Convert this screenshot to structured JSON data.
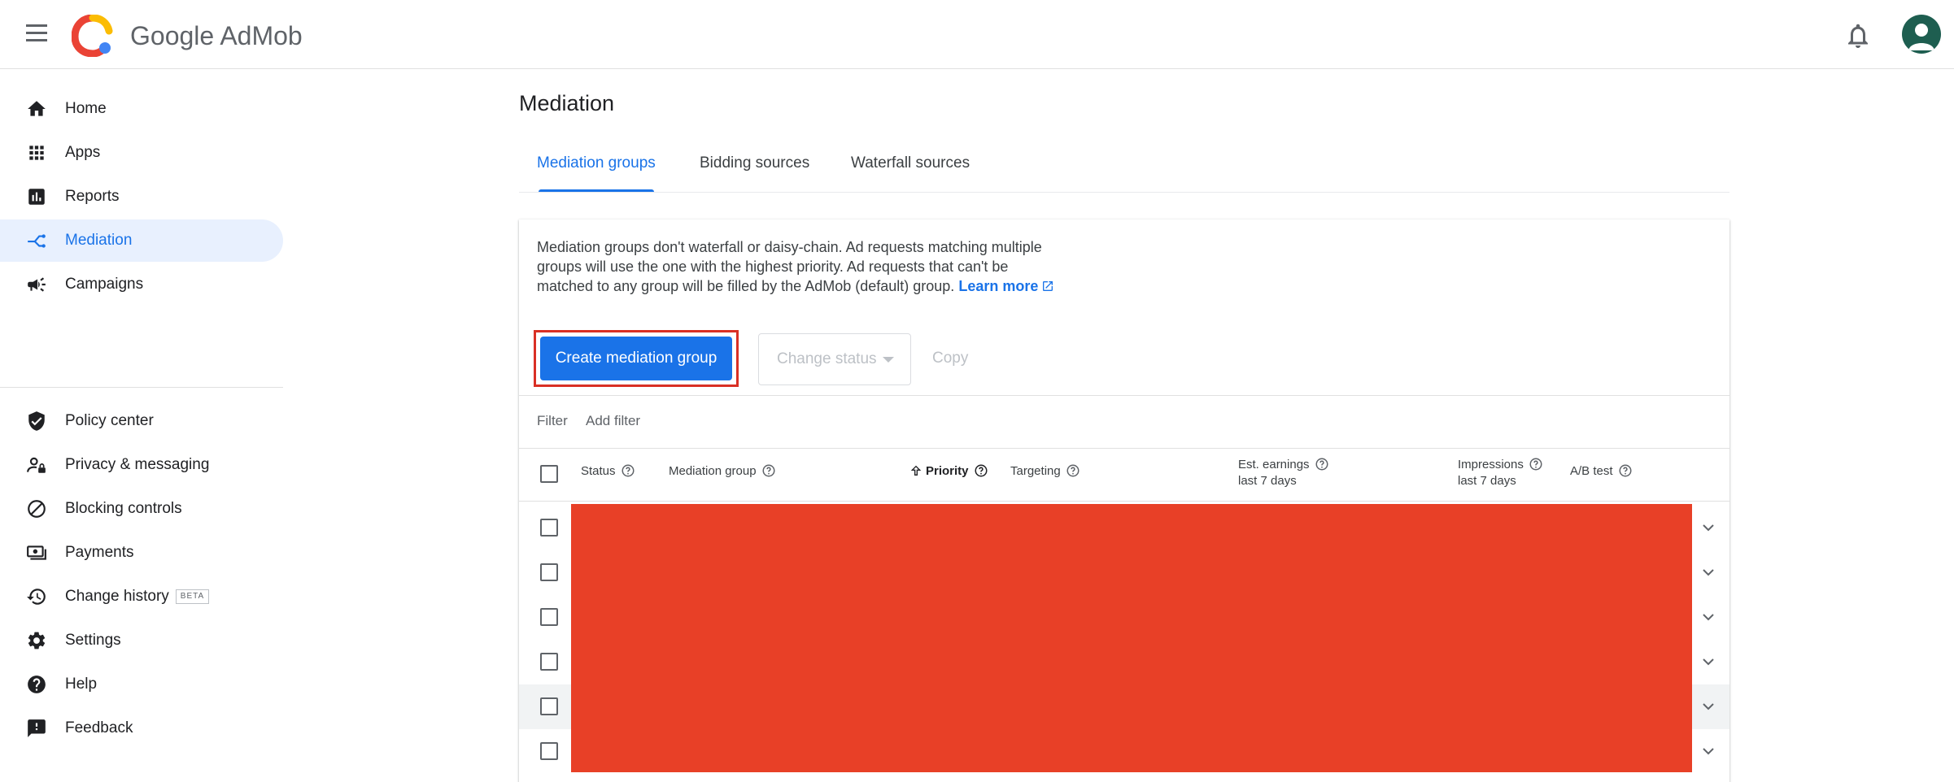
{
  "header": {
    "brand_google": "Google",
    "brand_product": "AdMob",
    "icons": [
      "menu-icon",
      "admob-logo-icon",
      "bell-icon",
      "account-avatar-icon"
    ]
  },
  "sidebar": {
    "items": [
      {
        "label": "Home",
        "icon": "home-icon"
      },
      {
        "label": "Apps",
        "icon": "apps-grid-icon"
      },
      {
        "label": "Reports",
        "icon": "reports-icon"
      },
      {
        "label": "Mediation",
        "icon": "mediation-icon",
        "active": true
      },
      {
        "label": "Campaigns",
        "icon": "megaphone-icon"
      },
      {
        "label": "Policy center",
        "icon": "shield-icon"
      },
      {
        "label": "Privacy & messaging",
        "icon": "person-lock-icon"
      },
      {
        "label": "Blocking controls",
        "icon": "block-icon"
      },
      {
        "label": "Payments",
        "icon": "payments-icon"
      },
      {
        "label": "Change history",
        "icon": "history-icon",
        "badge": "BETA"
      },
      {
        "label": "Settings",
        "icon": "gear-icon"
      },
      {
        "label": "Help",
        "icon": "help-icon"
      },
      {
        "label": "Feedback",
        "icon": "feedback-icon"
      }
    ]
  },
  "main": {
    "title": "Mediation",
    "tabs": [
      {
        "label": "Mediation groups",
        "active": true
      },
      {
        "label": "Bidding sources"
      },
      {
        "label": "Waterfall sources"
      }
    ],
    "description": "Mediation groups don't waterfall or daisy-chain. Ad requests matching multiple groups will use the one with the highest priority. Ad requests that can't be matched to any group will be filled by the AdMob (default) group.",
    "learn_more": "Learn more",
    "actions": {
      "create": "Create mediation group",
      "change_status": "Change status",
      "copy": "Copy"
    },
    "filter": {
      "label": "Filter",
      "add": "Add filter"
    },
    "table": {
      "columns": {
        "status": "Status",
        "group": "Mediation group",
        "priority": "Priority",
        "targeting": "Targeting",
        "earnings_line1": "Est. earnings",
        "earnings_line2": "last 7 days",
        "impressions_line1": "Impressions",
        "impressions_line2": "last 7 days",
        "ab_test": "A/B test"
      },
      "row_count": 6,
      "sort": "priority-ascending"
    }
  },
  "colors": {
    "accent": "#1a73e8",
    "active_nav_bg": "#e8f0fe",
    "highlight_border": "#d93025",
    "redaction": "#e84027"
  }
}
